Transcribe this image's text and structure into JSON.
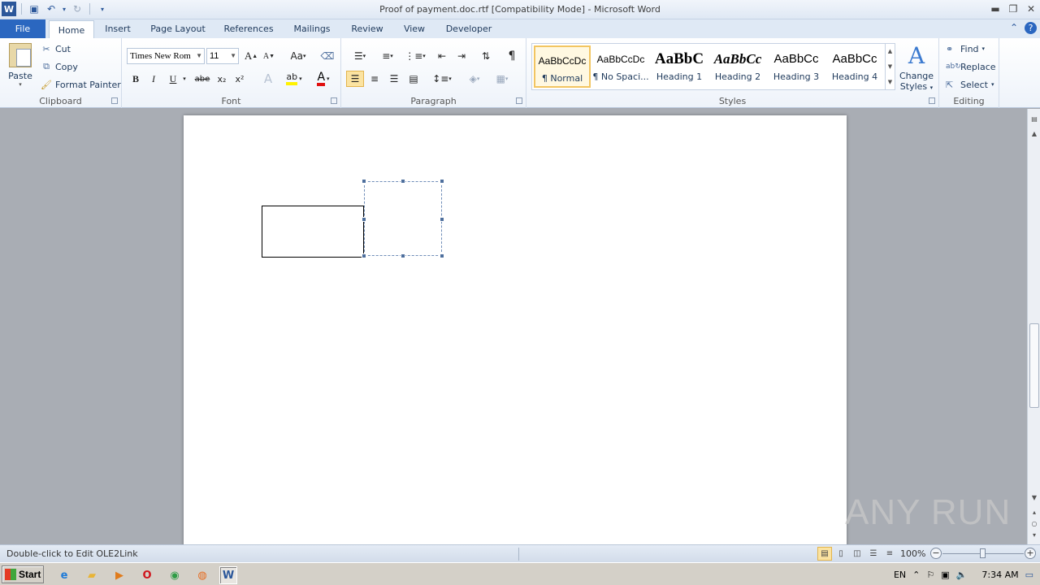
{
  "window": {
    "title": "Proof of payment.doc.rtf [Compatibility Mode]  -  Microsoft Word"
  },
  "tabs": {
    "file": "File",
    "home": "Home",
    "insert": "Insert",
    "page_layout": "Page Layout",
    "references": "References",
    "mailings": "Mailings",
    "review": "Review",
    "view": "View",
    "developer": "Developer"
  },
  "clipboard": {
    "paste": "Paste",
    "cut": "Cut",
    "copy": "Copy",
    "format_painter": "Format Painter",
    "label": "Clipboard"
  },
  "font": {
    "name": "Times New Rom",
    "size": "11",
    "label": "Font",
    "bold": "B",
    "italic": "I",
    "underline": "U",
    "strike": "abe",
    "subscript": "x₂",
    "superscript": "x²",
    "grow": "A",
    "shrink": "A",
    "change_case": "Aa",
    "font_color": "A"
  },
  "paragraph": {
    "label": "Paragraph",
    "pilcrow": "¶"
  },
  "styles": {
    "label": "Styles",
    "items": [
      {
        "sample": "AaBbCcDc",
        "name": "¶ Normal",
        "selected": true
      },
      {
        "sample": "AaBbCcDc",
        "name": "¶ No Spaci...",
        "selected": false
      },
      {
        "sample": "AaBbC",
        "name": "Heading 1",
        "selected": false
      },
      {
        "sample": "AaBbCc",
        "name": "Heading 2",
        "selected": false
      },
      {
        "sample": "AaBbCc",
        "name": "Heading 3",
        "selected": false
      },
      {
        "sample": "AaBbCc",
        "name": "Heading 4",
        "selected": false
      }
    ],
    "change_styles_line1": "Change",
    "change_styles_line2": "Styles"
  },
  "editing": {
    "label": "Editing",
    "find": "Find",
    "replace": "Replace",
    "select": "Select"
  },
  "status": {
    "message": "Double-click to Edit OLE2Link",
    "zoom": "100%",
    "zoom_minus": "−",
    "zoom_plus": "+"
  },
  "watermark": "ANY RUN",
  "taskbar": {
    "start": "Start",
    "language": "EN",
    "clock": "7:34 AM"
  },
  "colors": {
    "file_tab": "#2b67c0",
    "selected_style_border": "#f2c561",
    "font_color": "#e01010",
    "highlight": "#fff200"
  }
}
